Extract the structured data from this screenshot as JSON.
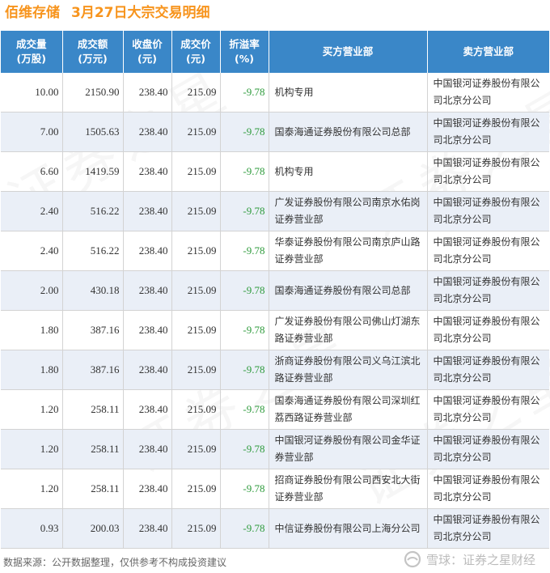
{
  "header": {
    "stock_name": "佰维存储",
    "subtitle": "3月27日大宗交易明细"
  },
  "table": {
    "columns": [
      [
        "成交量",
        "(万股)"
      ],
      [
        "成交额",
        "(万元)"
      ],
      [
        "收盘价",
        "(元)"
      ],
      [
        "成交价",
        "(元)"
      ],
      [
        "折溢率",
        "(%)"
      ],
      [
        "买方营业部"
      ],
      [
        "卖方营业部"
      ]
    ],
    "rows": [
      [
        "10.00",
        "2150.90",
        "238.40",
        "215.09",
        "-9.78",
        "机构专用",
        "中国银河证券股份有限公司北京分公司"
      ],
      [
        "7.00",
        "1505.63",
        "238.40",
        "215.09",
        "-9.78",
        "国泰海通证券股份有限公司总部",
        "中国银河证券股份有限公司北京分公司"
      ],
      [
        "6.60",
        "1419.59",
        "238.40",
        "215.09",
        "-9.78",
        "机构专用",
        "中国银河证券股份有限公司北京分公司"
      ],
      [
        "2.40",
        "516.22",
        "238.40",
        "215.09",
        "-9.78",
        "广发证券股份有限公司南京水佑岗证券营业部",
        "中国银河证券股份有限公司北京分公司"
      ],
      [
        "2.40",
        "516.22",
        "238.40",
        "215.09",
        "-9.78",
        "华泰证券股份有限公司南京庐山路证券营业部",
        "中国银河证券股份有限公司北京分公司"
      ],
      [
        "2.00",
        "430.18",
        "238.40",
        "215.09",
        "-9.78",
        "国泰海通证券股份有限公司总部",
        "中国银河证券股份有限公司北京分公司"
      ],
      [
        "1.80",
        "387.16",
        "238.40",
        "215.09",
        "-9.78",
        "广发证券股份有限公司佛山灯湖东路证券营业部",
        "中国银河证券股份有限公司北京分公司"
      ],
      [
        "1.80",
        "387.16",
        "238.40",
        "215.09",
        "-9.78",
        "浙商证券股份有限公司义乌江滨北路证券营业部",
        "中国银河证券股份有限公司北京分公司"
      ],
      [
        "1.20",
        "258.11",
        "238.40",
        "215.09",
        "-9.78",
        "国泰海通证券股份有限公司深圳红荔西路证券营业部",
        "中国银河证券股份有限公司北京分公司"
      ],
      [
        "1.20",
        "258.11",
        "238.40",
        "215.09",
        "-9.78",
        "中国银河证券股份有限公司金华证券营业部",
        "中国银河证券股份有限公司北京分公司"
      ],
      [
        "1.20",
        "258.11",
        "238.40",
        "215.09",
        "-9.78",
        "招商证券股份有限公司西安北大街证券营业部",
        "中国银河证券股份有限公司北京分公司"
      ],
      [
        "0.93",
        "200.03",
        "238.40",
        "215.09",
        "-9.78",
        "中信证券股份有限公司上海分公司",
        "中国银河证券股份有限公司北京分公司"
      ]
    ]
  },
  "footer": {
    "source": "数据来源：公开数据整理，仅供参考不构成投资建议",
    "brand": "雪球：证券之星财经"
  },
  "watermark": "证券之星",
  "colors": {
    "title": "#f7941d",
    "header_bg": "#3a87c8",
    "row_alt_bg": "#eaeff7",
    "rate_text": "#2e9b3c"
  }
}
